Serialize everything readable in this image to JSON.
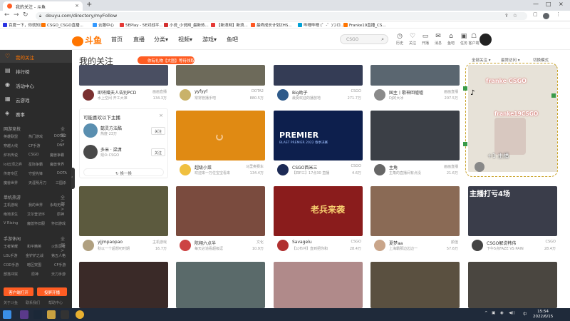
{
  "browser": {
    "tab_title": "我的关注 - 斗鱼",
    "tab_close": "×",
    "new_tab": "+",
    "url": "douyu.com/directory/myFollow",
    "window_controls": [
      "—",
      "□",
      "×"
    ]
  },
  "bookmarks": [
    {
      "label": "百度一下，你就知道",
      "color": "#2932e1"
    },
    {
      "label": "CSGO_CSGO直播...",
      "color": "#ff7500"
    },
    {
      "label": "云服中心",
      "color": "#3399ff"
    },
    {
      "label": "5EPlay - 5E对战平...",
      "color": "#e53935"
    },
    {
      "label": "小说_小说网_最新热...",
      "color": "#d32f2f"
    },
    {
      "label": "【新浪网】新浪...",
      "color": "#e53935"
    },
    {
      "label": "最终成长计划ZHS...",
      "color": "#ff5722"
    },
    {
      "label": "哔哩哔哩 (゜-゜)つロ...",
      "color": "#00a1d6"
    },
    {
      "label": "Franke19直播_CS...",
      "color": "#ff7500"
    }
  ],
  "header": {
    "logo_text": "斗鱼",
    "nav": [
      "首页",
      "直播",
      "分类▾",
      "视频▾",
      "游戏▾",
      "鱼吧"
    ],
    "search_placeholder": "CSGO",
    "icons": [
      {
        "glyph": "◷",
        "label": "历史"
      },
      {
        "glyph": "♡",
        "label": "关注"
      },
      {
        "glyph": "▭",
        "label": "开播"
      },
      {
        "glyph": "✉",
        "label": "消息"
      },
      {
        "glyph": "⌂",
        "label": "鱼吧"
      },
      {
        "glyph": "▣",
        "label": "任务"
      },
      {
        "glyph": "☖",
        "label": "客户端"
      }
    ]
  },
  "sidebar": {
    "items": [
      {
        "icon": "♡",
        "label": "我的关注",
        "active": true
      },
      {
        "icon": "▤",
        "label": "排行榜",
        "active": false
      },
      {
        "icon": "◉",
        "label": "活动中心",
        "active": false
      },
      {
        "icon": "▦",
        "label": "云游戏",
        "active": false
      },
      {
        "icon": "◈",
        "label": "赛事",
        "active": false
      }
    ],
    "sections": [
      {
        "title": "网游竞技",
        "more": "全部>",
        "entries": [
          "英雄联盟",
          "热门游戏",
          "DOTA2",
          "穿越火线",
          "CF手游",
          "DNF",
          "炉石传说",
          "CSGO",
          "魔兽争霸",
          "lol云顶之弈",
          "星际争霸",
          "魔兽世界",
          "传奇专区",
          "守望先锋",
          "DOTA",
          "魔兽世界",
          "天涯明月刀",
          "三国杀"
        ]
      },
      {
        "title": "单机热游",
        "more": "全部>",
        "entries": [
          "主机游戏",
          "我的世界",
          "永劫无间",
          "绝地求生",
          "艾尔登法环",
          "原神",
          "V Rising",
          "魔兽怀旧服",
          "怀旧游戏"
        ]
      },
      {
        "title": "手游休闲",
        "more": "全部>",
        "entries": [
          "王者荣耀",
          "和平精英",
          "火影忍者",
          "LOL手游",
          "金铲铲之战",
          "第五人格",
          "COD手游",
          "暗区突围",
          "CF手游",
          "部落冲突",
          "原神",
          "天刀手游"
        ]
      }
    ],
    "bottom_buttons": [
      "客户端打开",
      "投屏开播"
    ],
    "footer": [
      "关于斗鱼",
      "联系我们",
      "帮助中心"
    ]
  },
  "main": {
    "title": "我的关注",
    "promo": "你有礼物【大图】等待领取",
    "filters": [
      "全部关注 ▾",
      "最常访问 ▾",
      "切换模式"
    ],
    "recommend": {
      "title": "可能喜欢以下主播",
      "close": "×",
      "anchors": [
        {
          "name": "懿灵方法酷",
          "desc": "热度·23万",
          "follow": "关注"
        },
        {
          "name": "多米 · 梁潇",
          "desc": "观众·CSGO",
          "follow": "关注"
        }
      ],
      "refresh": "换一换"
    },
    "cards": [
      {
        "name": "即将赠夫人告别PCD",
        "sub": "水上空间 开工大准",
        "cat": "画画直播",
        "hot": "134.3万",
        "thumb": "#4a4f62"
      },
      {
        "name": "yyfyyf",
        "sub": "常常管播手吧",
        "cat": "DOTA2",
        "hot": "880.5万",
        "thumb": "#6d6a5a"
      },
      {
        "name": "Big助子",
        "sub": "最受欢迎的播放地",
        "cat": "CSGO",
        "hot": "271.7万",
        "thumb": "#343c55"
      },
      {
        "name": "国主丨歌神回嘘嘘",
        "sub": "DJ的大冰",
        "cat": "画画直播",
        "hot": "207.5万",
        "thumb": "#5a6670"
      },
      {
        "name": "摇曳小猪",
        "sub": "",
        "cat": "CSGO",
        "hot": "",
        "thumb": "#d9d3c8"
      },
      {
        "name": "超级小菜",
        "sub": "欢迎来一万位宝宝看来",
        "cat": "马里奥赛车",
        "hot": "134.4万",
        "thumb": "#e08a13"
      },
      {
        "name": "CSGO西米三",
        "sub": "【四P三】17点30 直播",
        "cat": "CSGO",
        "hot": "4.6万",
        "thumb": "#0d1f4d"
      },
      {
        "name": "主角",
        "sub": "主角的直播间有点没",
        "cat": "画画直播",
        "hot": "21.6万",
        "thumb": "#3b3f46"
      },
      {
        "name": "yjjmpaopao",
        "sub": "秋以一个超想叨时期",
        "cat": "主机游戏",
        "hot": "16.7万",
        "thumb": "#5c5a3e"
      },
      {
        "name": "陈翔六点半",
        "sub": "每天必追看超级逗",
        "cat": "文化",
        "hot": "10.9万",
        "thumb": "#7a4b3e"
      },
      {
        "name": "Savagelu",
        "sub": "【公布冲】直到把你和",
        "cat": "CSGO",
        "hot": "28.4万",
        "thumb": "#8a1c1c"
      },
      {
        "name": "夏梦aa",
        "sub": "上海霸那边边边一",
        "cat": "颜值",
        "hot": "57.6万",
        "thumb": "#8a6a55"
      },
      {
        "name": "CSGO解说韩伟",
        "sub": "下午5点FAZE VS PAIN",
        "cat": "CSGO",
        "hot": "28.4万",
        "thumb": "#3a3d4a"
      },
      {
        "name": "",
        "sub": "",
        "cat": "",
        "hot": "",
        "thumb": "#3a2a28"
      },
      {
        "name": "",
        "sub": "",
        "cat": "",
        "hot": "",
        "thumb": "#5a6a6a"
      },
      {
        "name": "",
        "sub": "",
        "cat": "",
        "hot": "",
        "thumb": "#b08a8a"
      },
      {
        "name": "",
        "sub": "",
        "cat": "",
        "hot": "",
        "thumb": "#5a5040"
      },
      {
        "name": "",
        "sub": "",
        "cat": "",
        "hot": "",
        "thumb": "#4a4640"
      }
    ],
    "card_texts": {
      "premier_title": "PREMIER",
      "premier_sub": "BLAST PREMIER 2022 春季决赛",
      "event_text": "老兵来袭",
      "stream_title": "主播打亏4场",
      "overlay_name": "franke CSGO",
      "overlay_name2": "franke19CSGO",
      "overlay_bottom": "+1 主播"
    }
  },
  "taskbar": {
    "time": "15:54",
    "date": "2022/6/15",
    "tray": [
      "^",
      "▣",
      "◉",
      "◀))",
      "中"
    ]
  }
}
